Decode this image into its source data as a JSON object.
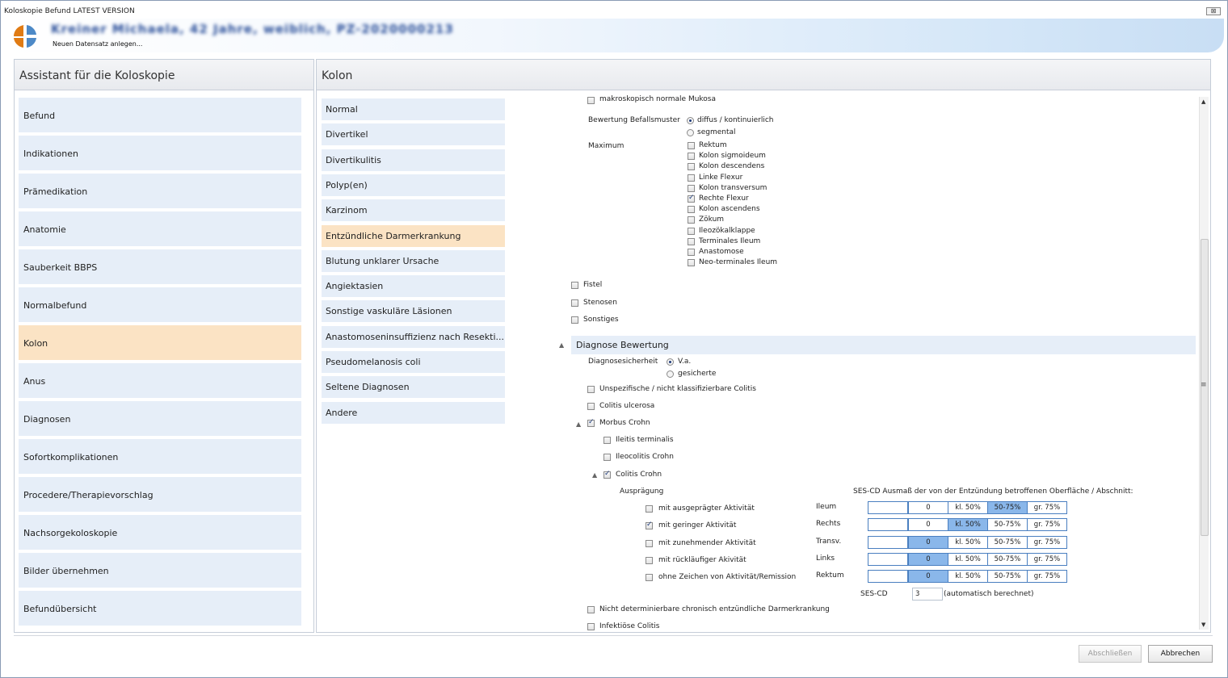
{
  "window": {
    "title": "Koloskopie Befund LATEST VERSION",
    "close_glyph": "⊠"
  },
  "header": {
    "patient": "Kreiner Michaela, 42 Jahre, weiblich, PZ-2020000213",
    "subtitle": "Neuen Datensatz anlegen..."
  },
  "left": {
    "title": "Assistant für die Koloskopie",
    "items": [
      {
        "label": "Befund",
        "done": true
      },
      {
        "label": "Indikationen",
        "done": true
      },
      {
        "label": "Prämedikation",
        "done": true
      },
      {
        "label": "Anatomie",
        "done": true
      },
      {
        "label": "Sauberkeit BBPS",
        "done": true
      },
      {
        "label": "Normalbefund",
        "done": true
      },
      {
        "label": "Kolon",
        "done": true,
        "selected": true
      },
      {
        "label": "Anus",
        "done": false
      },
      {
        "label": "Diagnosen",
        "done": true
      },
      {
        "label": "Sofortkomplikationen",
        "done": false
      },
      {
        "label": "Procedere/Therapievorschlag",
        "done": false
      },
      {
        "label": "Nachsorgekoloskopie",
        "done": false
      },
      {
        "label": "Bilder übernehmen",
        "done": true
      },
      {
        "label": "Befundübersicht",
        "done": false
      }
    ]
  },
  "right": {
    "title": "Kolon",
    "items": [
      {
        "label": "Normal"
      },
      {
        "label": "Divertikel"
      },
      {
        "label": "Divertikulitis"
      },
      {
        "label": "Polyp(en)"
      },
      {
        "label": "Karzinom"
      },
      {
        "label": "Entzündliche Darmerkrankung",
        "selected": true,
        "done": true
      },
      {
        "label": "Blutung unklarer Ursache"
      },
      {
        "label": "Angiektasien"
      },
      {
        "label": "Sonstige vaskuläre Läsionen"
      },
      {
        "label": "Anastomoseninsuffizienz nach Resekti..."
      },
      {
        "label": "Pseudomelanosis coli"
      },
      {
        "label": "Seltene Diagnosen"
      },
      {
        "label": "Andere"
      }
    ]
  },
  "form": {
    "mucosa_label": "makroskopisch normale Mukosa",
    "befallsmuster": {
      "label": "Bewertung Befallsmuster",
      "options": [
        "diffus / kontinuierlich",
        "segmental"
      ],
      "selected": 0
    },
    "maximum": {
      "label": "Maximum",
      "options": [
        {
          "label": "Rektum",
          "checked": false
        },
        {
          "label": "Kolon sigmoideum",
          "checked": false
        },
        {
          "label": "Kolon descendens",
          "checked": false
        },
        {
          "label": "Linke Flexur",
          "checked": false
        },
        {
          "label": "Kolon transversum",
          "checked": false
        },
        {
          "label": "Rechte Flexur",
          "checked": true
        },
        {
          "label": "Kolon ascendens",
          "checked": false
        },
        {
          "label": "Zökum",
          "checked": false
        },
        {
          "label": "Ileozökalklappe",
          "checked": false
        },
        {
          "label": "Terminales Ileum",
          "checked": false
        },
        {
          "label": "Anastomose",
          "checked": false
        },
        {
          "label": "Neo-terminales Ileum",
          "checked": false
        }
      ]
    },
    "extras": [
      {
        "label": "Fistel",
        "checked": false
      },
      {
        "label": "Stenosen",
        "checked": false
      },
      {
        "label": "Sonstiges",
        "checked": false
      }
    ],
    "diag_section": "Diagnose Bewertung",
    "sicherheit": {
      "label": "Diagnosesicherheit",
      "options": [
        "V.a.",
        "gesicherte"
      ],
      "selected": 0
    },
    "unspezifisch": "Unspezifische / nicht klassifizierbare Colitis",
    "colitis_ulcerosa": "Colitis ulcerosa",
    "crohn": "Morbus Crohn",
    "ileitis": "Ileitis terminalis",
    "ileocolitis": "Ileocolitis Crohn",
    "colitis_crohn": "Colitis Crohn",
    "auspraegung_label": "Ausprägung",
    "auspraegung": [
      {
        "label": "mit ausgeprägter Aktivität",
        "checked": false
      },
      {
        "label": "mit geringer Aktivität",
        "checked": true
      },
      {
        "label": "mit zunehmender Aktivität",
        "checked": false
      },
      {
        "label": "mit rückläufiger Akivität",
        "checked": false
      },
      {
        "label": "ohne Zeichen von Aktivität/Remission",
        "checked": false
      }
    ],
    "ses_header": "SES-CD Ausmaß der von der Entzündung betroffenen Oberfläche / Abschnitt:",
    "ses_rows": [
      {
        "segment": "Ileum",
        "value": "0",
        "opts": [
          "kl. 50%",
          "50-75%",
          "gr. 75%"
        ],
        "sel": 2
      },
      {
        "segment": "Rechts",
        "value": "0",
        "opts": [
          "kl. 50%",
          "50-75%",
          "gr. 75%"
        ],
        "sel": 1
      },
      {
        "segment": "Transv.",
        "value": "0",
        "opts": [
          "kl. 50%",
          "50-75%",
          "gr. 75%"
        ],
        "sel": 0
      },
      {
        "segment": "Links",
        "value": "0",
        "opts": [
          "kl. 50%",
          "50-75%",
          "gr. 75%"
        ],
        "sel": 0
      },
      {
        "segment": "Rektum",
        "value": "0",
        "opts": [
          "kl. 50%",
          "50-75%",
          "gr. 75%"
        ],
        "sel": 0
      }
    ],
    "ses_total_label": "SES-CD",
    "ses_total_value": "3",
    "ses_total_note": "(automatisch berechnet)",
    "nicht_det": "Nicht determinierbare chronisch entzündliche Darmerkrankung",
    "infektioes": "Infektiöse Colitis"
  },
  "buttons": {
    "finish": "Abschließen",
    "cancel": "Abbrechen"
  },
  "colors": {
    "nav_bg": "#e6eef8",
    "selected_bg": "#fbe3c4",
    "done_bar": "#7bc27f",
    "header_blue": "#2a4f9a"
  }
}
